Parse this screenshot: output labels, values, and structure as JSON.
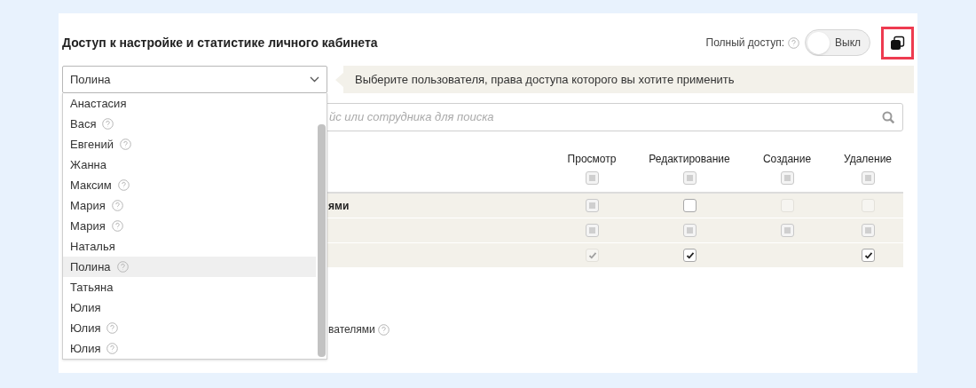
{
  "title": "Доступ к настройке и статистике личного кабинета",
  "full_access": {
    "label": "Полный доступ:",
    "on": false,
    "state_text": "Выкл"
  },
  "user_select": {
    "value": "Полина",
    "expanded": true
  },
  "hint": "Выберите пользователя, права доступа которого вы хотите применить",
  "search": {
    "placeholder": "йс или сотрудника для поиска"
  },
  "columns": [
    "Просмотр",
    "Редактирование",
    "Создание",
    "Удаление"
  ],
  "header_boxes": [
    {
      "kind": "checkbox",
      "checked": false,
      "indeterminate": true,
      "disabled": false
    },
    {
      "kind": "checkbox",
      "checked": false,
      "indeterminate": true,
      "disabled": false
    },
    {
      "kind": "checkbox",
      "checked": false,
      "indeterminate": true,
      "disabled": false
    },
    {
      "kind": "checkbox",
      "checked": false,
      "indeterminate": true,
      "disabled": false
    }
  ],
  "rows": [
    {
      "label": "ями",
      "cells": [
        {
          "kind": "checkbox",
          "checked": false,
          "indeterminate": true,
          "disabled": false
        },
        {
          "kind": "checkbox",
          "checked": false,
          "indeterminate": false,
          "disabled": false
        },
        {
          "kind": "checkbox",
          "checked": false,
          "indeterminate": false,
          "disabled": true
        },
        {
          "kind": "checkbox",
          "checked": false,
          "indeterminate": false,
          "disabled": true
        }
      ]
    },
    {
      "cells": [
        {
          "kind": "checkbox",
          "checked": false,
          "indeterminate": true,
          "disabled": false
        },
        {
          "kind": "checkbox",
          "checked": false,
          "indeterminate": true,
          "disabled": false
        },
        {
          "kind": "checkbox",
          "checked": false,
          "indeterminate": true,
          "disabled": false
        },
        {
          "kind": "checkbox",
          "checked": false,
          "indeterminate": true,
          "disabled": false
        }
      ]
    },
    {
      "cells": [
        {
          "kind": "checkbox",
          "checked": true,
          "indeterminate": false,
          "disabled": true
        },
        {
          "kind": "checkbox",
          "checked": true,
          "indeterminate": false,
          "disabled": false
        },
        {
          "kind": "blank"
        },
        {
          "kind": "checkbox",
          "checked": true,
          "indeterminate": false,
          "disabled": false
        }
      ]
    }
  ],
  "footer_text": "вателями",
  "users": [
    {
      "name": "Анастасия",
      "help": false,
      "selected": false
    },
    {
      "name": "Вася",
      "help": true,
      "selected": false
    },
    {
      "name": "Евгений",
      "help": true,
      "selected": false
    },
    {
      "name": "Жанна",
      "help": false,
      "selected": false
    },
    {
      "name": "Максим",
      "help": true,
      "selected": false
    },
    {
      "name": "Мария",
      "help": true,
      "selected": false
    },
    {
      "name": "Мария",
      "help": true,
      "selected": false
    },
    {
      "name": "Наталья",
      "help": false,
      "selected": false
    },
    {
      "name": "Полина",
      "help": true,
      "selected": true
    },
    {
      "name": "Татьяна",
      "help": false,
      "selected": false
    },
    {
      "name": "Юлия",
      "help": false,
      "selected": false
    },
    {
      "name": "Юлия",
      "help": true,
      "selected": false
    },
    {
      "name": "Юлия",
      "help": true,
      "selected": false
    }
  ]
}
